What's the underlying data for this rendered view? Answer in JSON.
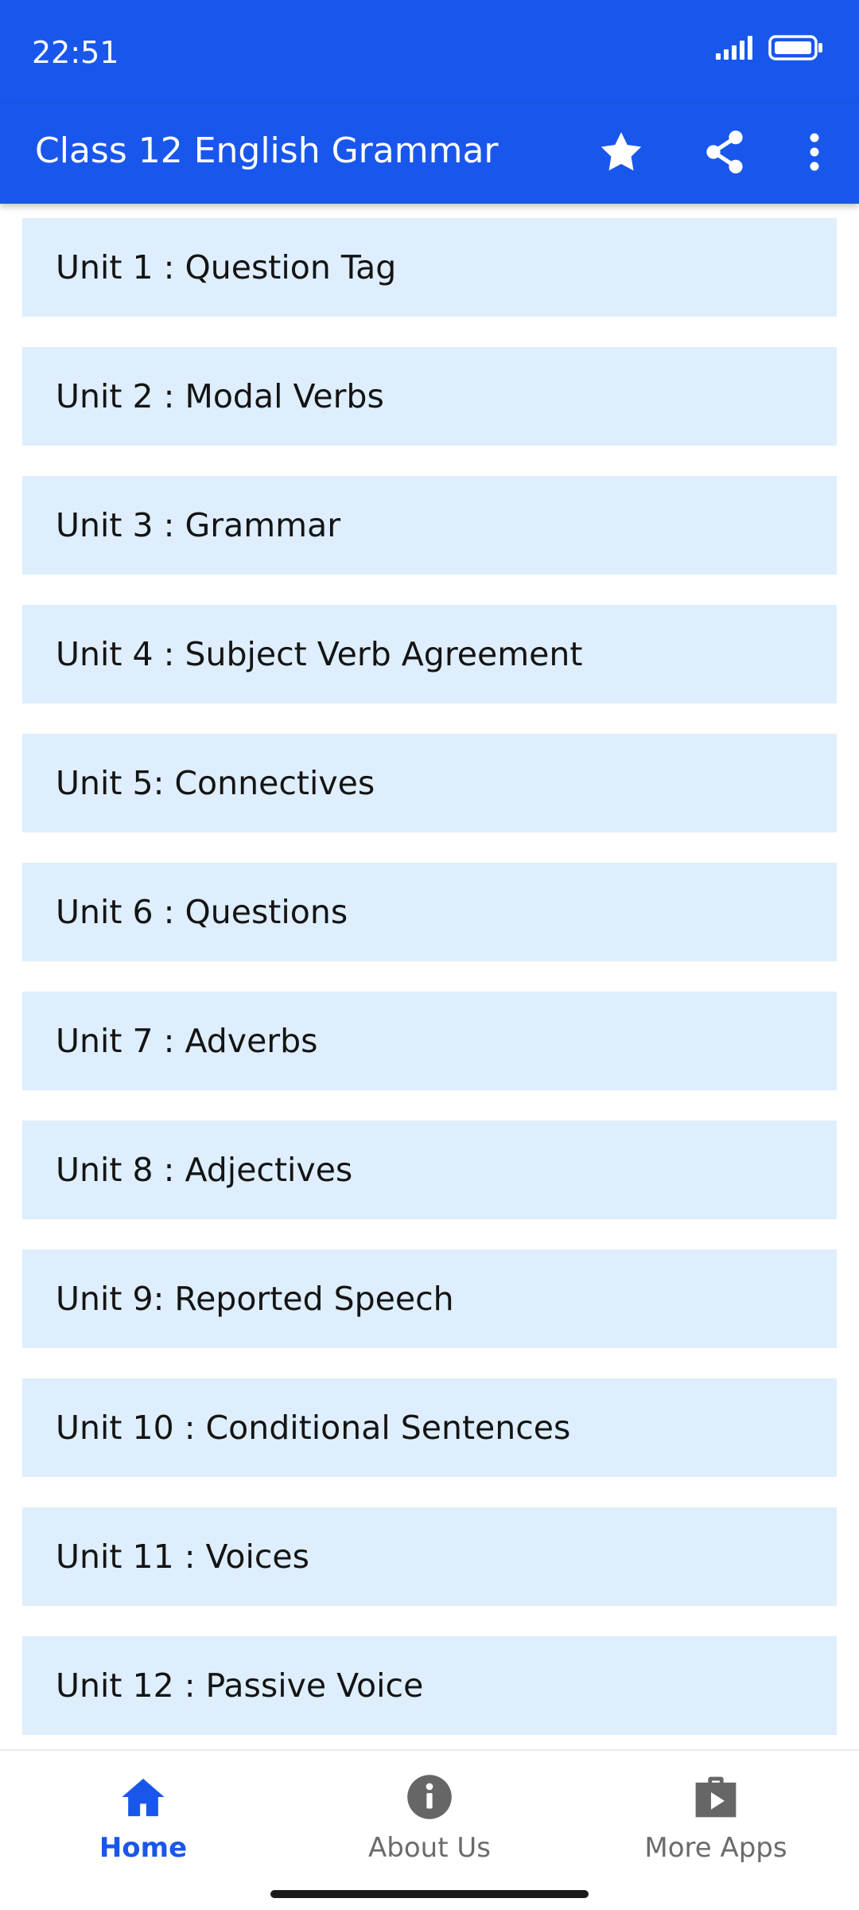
{
  "status_bar": {
    "time": "22:51",
    "icons": [
      "signal-icon",
      "battery-icon"
    ]
  },
  "app_bar": {
    "title": "Class 12 English Grammar",
    "actions": [
      "star-icon",
      "share-icon",
      "more-vertical-icon"
    ]
  },
  "units": [
    {
      "label": "Unit 1 : Question Tag"
    },
    {
      "label": "Unit 2 : Modal Verbs"
    },
    {
      "label": "Unit 3 : Grammar"
    },
    {
      "label": "Unit 4 : Subject Verb Agreement"
    },
    {
      "label": "Unit 5: Connectives"
    },
    {
      "label": "Unit 6 : Questions"
    },
    {
      "label": "Unit 7 : Adverbs"
    },
    {
      "label": "Unit 8 : Adjectives"
    },
    {
      "label": "Unit 9: Reported Speech"
    },
    {
      "label": "Unit 10 : Conditional Sentences"
    },
    {
      "label": "Unit 11 : Voices"
    },
    {
      "label": "Unit 12 : Passive Voice"
    }
  ],
  "bottom_nav": {
    "items": [
      {
        "label": "Home",
        "icon": "home-icon",
        "active": true
      },
      {
        "label": "About Us",
        "icon": "info-icon",
        "active": false
      },
      {
        "label": "More Apps",
        "icon": "store-bag-icon",
        "active": false
      }
    ]
  },
  "colors": {
    "primary": "#1957EC",
    "item_background": "#DEEEFD",
    "text": "#141414",
    "nav_inactive": "#6b6b6b"
  }
}
